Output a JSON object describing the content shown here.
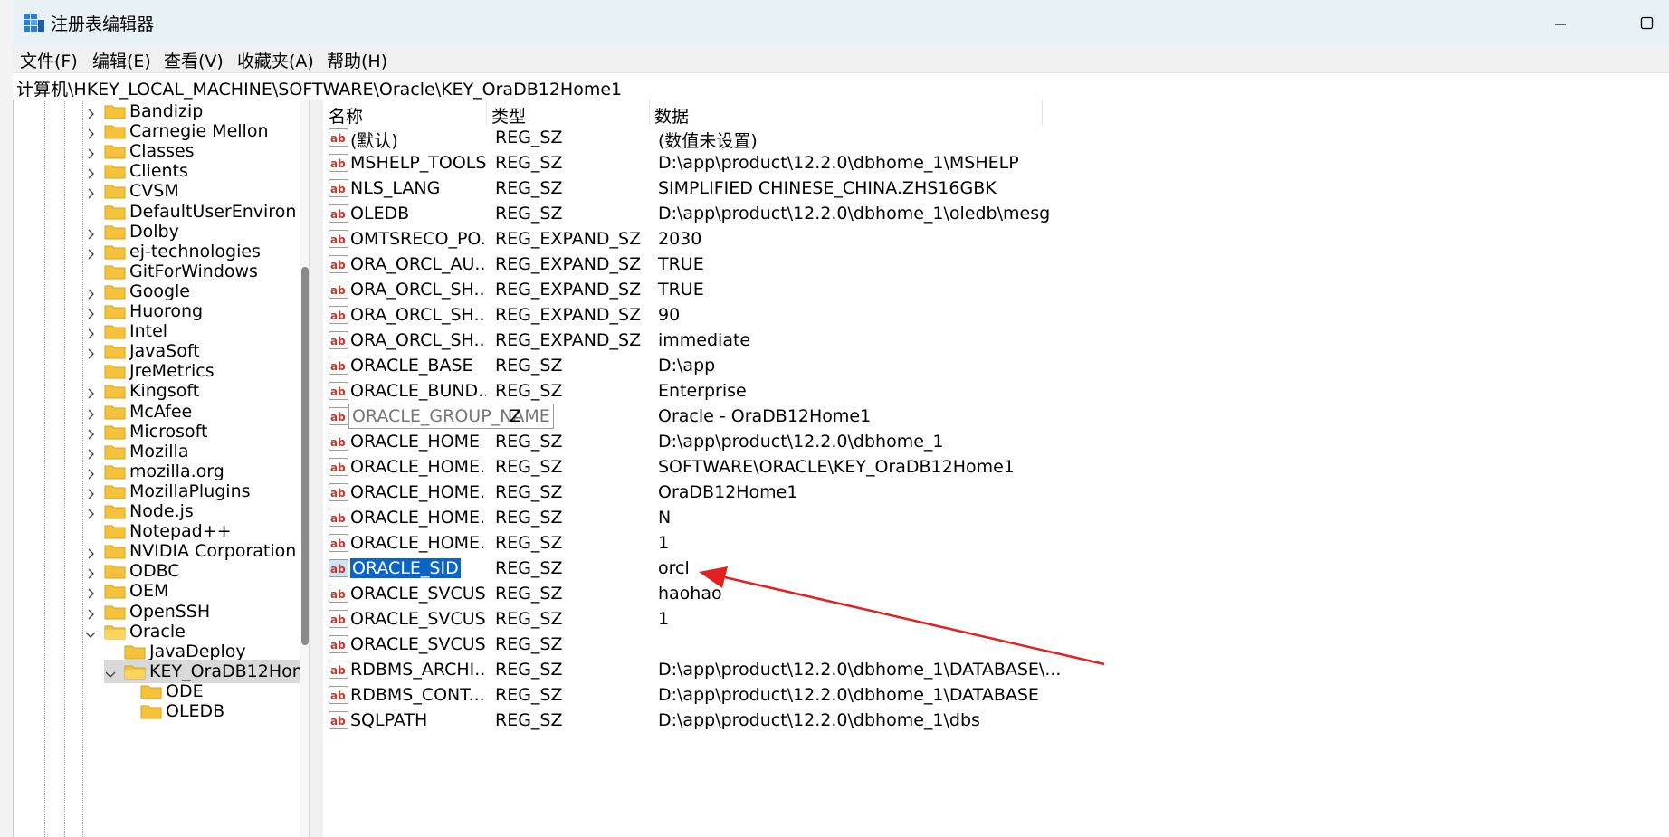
{
  "window": {
    "title": "注册表编辑器",
    "accent_color": "#0a64c8",
    "arrow_color": "#e32020"
  },
  "menu": [
    "文件(F)",
    "编辑(E)",
    "查看(V)",
    "收藏夹(A)",
    "帮助(H)"
  ],
  "address": "计算机\\HKEY_LOCAL_MACHINE\\SOFTWARE\\Oracle\\KEY_OraDB12Home1",
  "tree": {
    "items": [
      {
        "label": "Bandizip",
        "expandable": true
      },
      {
        "label": "Carnegie Mellon",
        "expandable": true
      },
      {
        "label": "Classes",
        "expandable": true
      },
      {
        "label": "Clients",
        "expandable": true
      },
      {
        "label": "CVSM",
        "expandable": true
      },
      {
        "label": "DefaultUserEnviron",
        "expandable": false
      },
      {
        "label": "Dolby",
        "expandable": true
      },
      {
        "label": "ej-technologies",
        "expandable": true
      },
      {
        "label": "GitForWindows",
        "expandable": false
      },
      {
        "label": "Google",
        "expandable": true
      },
      {
        "label": "Huorong",
        "expandable": true
      },
      {
        "label": "Intel",
        "expandable": true
      },
      {
        "label": "JavaSoft",
        "expandable": true
      },
      {
        "label": "JreMetrics",
        "expandable": false
      },
      {
        "label": "Kingsoft",
        "expandable": true
      },
      {
        "label": "McAfee",
        "expandable": true
      },
      {
        "label": "Microsoft",
        "expandable": true
      },
      {
        "label": "Mozilla",
        "expandable": true
      },
      {
        "label": "mozilla.org",
        "expandable": true
      },
      {
        "label": "MozillaPlugins",
        "expandable": true
      },
      {
        "label": "Node.js",
        "expandable": true
      },
      {
        "label": "Notepad++",
        "expandable": false
      },
      {
        "label": "NVIDIA Corporation",
        "expandable": true
      },
      {
        "label": "ODBC",
        "expandable": true
      },
      {
        "label": "OEM",
        "expandable": true
      },
      {
        "label": "OpenSSH",
        "expandable": true
      },
      {
        "label": "Oracle",
        "expandable": true,
        "expanded": true
      }
    ],
    "oracle_children": [
      "JavaDeploy",
      "KEY_OraDB12Home1"
    ],
    "key_children": [
      "ODE",
      "OLEDB"
    ]
  },
  "columns": [
    "名称",
    "类型",
    "数据"
  ],
  "values": [
    {
      "name": "(默认)",
      "type": "REG_SZ",
      "data": "(数值未设置)"
    },
    {
      "name": "MSHELP_TOOLS",
      "type": "REG_SZ",
      "data": "D:\\app\\product\\12.2.0\\dbhome_1\\MSHELP"
    },
    {
      "name": "NLS_LANG",
      "type": "REG_SZ",
      "data": "SIMPLIFIED CHINESE_CHINA.ZHS16GBK"
    },
    {
      "name": "OLEDB",
      "type": "REG_SZ",
      "data": "D:\\app\\product\\12.2.0\\dbhome_1\\oledb\\mesg"
    },
    {
      "name": "OMTSRECO_PO...",
      "type": "REG_EXPAND_SZ",
      "data": "2030"
    },
    {
      "name": "ORA_ORCL_AU...",
      "type": "REG_EXPAND_SZ",
      "data": "TRUE"
    },
    {
      "name": "ORA_ORCL_SH...",
      "type": "REG_EXPAND_SZ",
      "data": "TRUE"
    },
    {
      "name": "ORA_ORCL_SH...",
      "type": "REG_EXPAND_SZ",
      "data": "90"
    },
    {
      "name": "ORA_ORCL_SH...",
      "type": "REG_EXPAND_SZ",
      "data": "immediate"
    },
    {
      "name": "ORACLE_BASE",
      "type": "REG_SZ",
      "data": "D:\\app"
    },
    {
      "name": "ORACLE_BUND...",
      "type": "REG_SZ",
      "data": "Enterprise"
    },
    {
      "name": "ORACLE_GROUP_NAME",
      "type": "Z",
      "data": "Oracle - OraDB12Home1",
      "editing": true
    },
    {
      "name": "ORACLE_HOME",
      "type": "REG_SZ",
      "data": "D:\\app\\product\\12.2.0\\dbhome_1"
    },
    {
      "name": "ORACLE_HOME...",
      "type": "REG_SZ",
      "data": "SOFTWARE\\ORACLE\\KEY_OraDB12Home1"
    },
    {
      "name": "ORACLE_HOME...",
      "type": "REG_SZ",
      "data": "OraDB12Home1"
    },
    {
      "name": "ORACLE_HOME...",
      "type": "REG_SZ",
      "data": "N"
    },
    {
      "name": "ORACLE_HOME...",
      "type": "REG_SZ",
      "data": "1"
    },
    {
      "name": "ORACLE_SID",
      "type": "REG_SZ",
      "data": "orcl",
      "selected": true
    },
    {
      "name": "ORACLE_SVCUS...",
      "type": "REG_SZ",
      "data": "haohao"
    },
    {
      "name": "ORACLE_SVCUS...",
      "type": "REG_SZ",
      "data": "1"
    },
    {
      "name": "ORACLE_SVCUS...",
      "type": "REG_SZ",
      "data": ""
    },
    {
      "name": "RDBMS_ARCHI...",
      "type": "REG_SZ",
      "data": "D:\\app\\product\\12.2.0\\dbhome_1\\DATABASE\\..."
    },
    {
      "name": "RDBMS_CONT...",
      "type": "REG_SZ",
      "data": "D:\\app\\product\\12.2.0\\dbhome_1\\DATABASE"
    },
    {
      "name": "SQLPATH",
      "type": "REG_SZ",
      "data": "D:\\app\\product\\12.2.0\\dbhome_1\\dbs"
    }
  ]
}
